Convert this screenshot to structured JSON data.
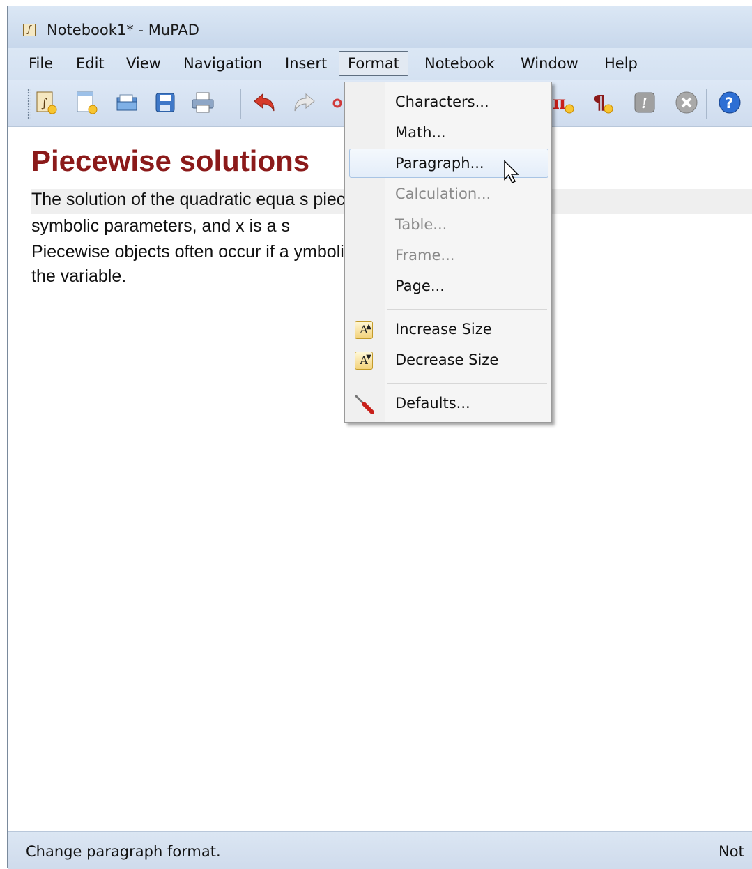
{
  "window": {
    "title": "Notebook1* - MuPAD"
  },
  "menubar": {
    "items": [
      "File",
      "Edit",
      "View",
      "Navigation",
      "Insert",
      "Format",
      "Notebook",
      "Window",
      "Help"
    ],
    "active": "Format"
  },
  "toolbar": {
    "icons": [
      "new-notebook-icon",
      "new-document-icon",
      "open-icon",
      "save-icon",
      "print-icon",
      "undo-icon",
      "redo-icon",
      "cut-icon",
      "insert-math-icon",
      "insert-paragraph-icon",
      "evaluate-icon",
      "stop-icon",
      "help-icon"
    ]
  },
  "document": {
    "heading": "Piecewise solutions",
    "para1_line1": "The solution of the quadratic equa                                  s piecewise. Here a, b,",
    "para1_line2": "symbolic parameters, and x is a s",
    "para2_line1": "Piecewise objects often occur if a                                  ymbolic parameters in",
    "para2_line2": "the variable."
  },
  "format_menu": {
    "items": [
      {
        "label": "Characters...",
        "enabled": true
      },
      {
        "label": "Math...",
        "enabled": true
      },
      {
        "label": "Paragraph...",
        "enabled": true,
        "highlighted": true
      },
      {
        "label": "Calculation...",
        "enabled": false
      },
      {
        "label": "Table...",
        "enabled": false
      },
      {
        "label": "Frame...",
        "enabled": false
      },
      {
        "label": "Page...",
        "enabled": true
      },
      {
        "label": "Increase Size",
        "enabled": true,
        "icon": "increase-size-icon"
      },
      {
        "label": "Decrease Size",
        "enabled": true,
        "icon": "decrease-size-icon"
      },
      {
        "label": "Defaults...",
        "enabled": true,
        "icon": "screwdriver-icon"
      }
    ]
  },
  "statusbar": {
    "message": "Change paragraph format.",
    "right_text": "Not"
  },
  "colors": {
    "heading": "#8b1a1a",
    "chrome": "#d4e1f1",
    "highlight_border": "#a8c4e4"
  }
}
